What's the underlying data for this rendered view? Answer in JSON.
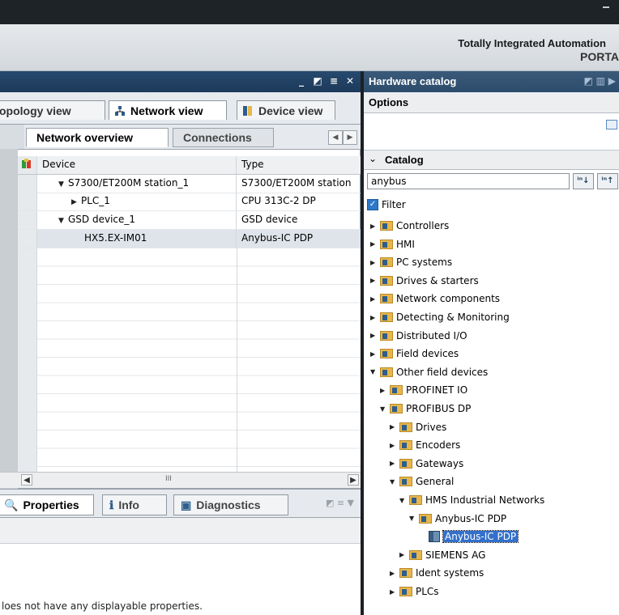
{
  "window": {
    "product_title": "Totally Integrated Automation",
    "product_sub": "PORTA"
  },
  "left_panel": {
    "view_tabs": [
      {
        "label": "opology view"
      },
      {
        "label": "Network view"
      },
      {
        "label": "Device view"
      }
    ],
    "sub_tabs": [
      {
        "label": "Network overview"
      },
      {
        "label": "Connections"
      }
    ],
    "table": {
      "columns": [
        "Device",
        "Type"
      ],
      "rows": [
        {
          "device": "S7300/ET200M station_1",
          "type": "S7300/ET200M station",
          "expanded": true,
          "indent": 1
        },
        {
          "device": "PLC_1",
          "type": "CPU 313C-2 DP",
          "expanded": false,
          "indent": 2
        },
        {
          "device": "GSD device_1",
          "type": "GSD device",
          "expanded": true,
          "indent": 1
        },
        {
          "device": "HX5.EX-IM01",
          "type": "Anybus-IC PDP",
          "expanded": null,
          "indent": 3
        }
      ]
    },
    "scrollbar_thumb": "III"
  },
  "properties_panel": {
    "tabs": [
      {
        "label": "Properties"
      },
      {
        "label": "Info"
      },
      {
        "label": "Diagnostics"
      }
    ],
    "message": "loes not have any displayable properties."
  },
  "right_panel": {
    "title": "Hardware catalog",
    "options_label": "Options",
    "catalog_label": "Catalog",
    "search_value": "anybus",
    "filter_label": "Filter",
    "tree": [
      {
        "label": "Controllers",
        "level": 0,
        "state": "collapsed"
      },
      {
        "label": "HMI",
        "level": 0,
        "state": "collapsed"
      },
      {
        "label": "PC systems",
        "level": 0,
        "state": "collapsed"
      },
      {
        "label": "Drives & starters",
        "level": 0,
        "state": "collapsed"
      },
      {
        "label": "Network components",
        "level": 0,
        "state": "collapsed"
      },
      {
        "label": "Detecting & Monitoring",
        "level": 0,
        "state": "collapsed"
      },
      {
        "label": "Distributed I/O",
        "level": 0,
        "state": "collapsed"
      },
      {
        "label": "Field devices",
        "level": 0,
        "state": "collapsed"
      },
      {
        "label": "Other field devices",
        "level": 0,
        "state": "expanded"
      },
      {
        "label": "PROFINET IO",
        "level": 1,
        "state": "collapsed"
      },
      {
        "label": "PROFIBUS DP",
        "level": 1,
        "state": "expanded"
      },
      {
        "label": "Drives",
        "level": 2,
        "state": "collapsed"
      },
      {
        "label": "Encoders",
        "level": 2,
        "state": "collapsed"
      },
      {
        "label": "Gateways",
        "level": 2,
        "state": "collapsed"
      },
      {
        "label": "General",
        "level": 2,
        "state": "expanded"
      },
      {
        "label": "HMS Industrial Networks",
        "level": 3,
        "state": "expanded"
      },
      {
        "label": "Anybus-IC PDP",
        "level": 4,
        "state": "expanded"
      },
      {
        "label": "Anybus-IC PDP",
        "level": 5,
        "state": "leaf-selected"
      },
      {
        "label": "SIEMENS AG",
        "level": 3,
        "state": "collapsed"
      },
      {
        "label": "Ident systems",
        "level": 2,
        "state": "collapsed"
      },
      {
        "label": "PLCs",
        "level": 2,
        "state": "collapsed"
      }
    ]
  }
}
